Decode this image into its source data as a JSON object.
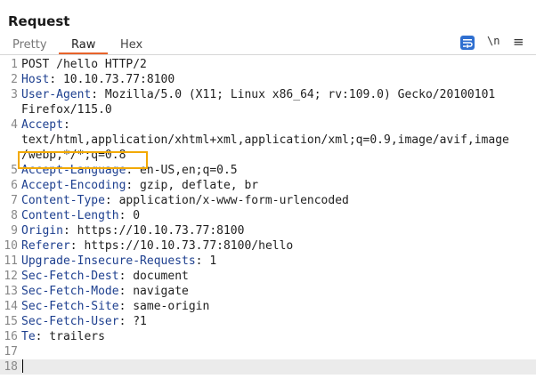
{
  "panel": {
    "title": "Request"
  },
  "tabs": [
    {
      "label": "Pretty",
      "active": false
    },
    {
      "label": "Raw",
      "active": true
    },
    {
      "label": "Hex",
      "active": false
    }
  ],
  "toolbar": {
    "newline_label": "\\n",
    "menu_glyph": "≡",
    "wrap_icon": "wrap-lines-icon",
    "accent": "#2f6fd0"
  },
  "editor": {
    "lines": [
      {
        "n": "1",
        "key": "",
        "text": "POST /hello HTTP/2"
      },
      {
        "n": "2",
        "key": "Host",
        "text": ": 10.10.73.77:8100"
      },
      {
        "n": "3",
        "key": "User-Agent",
        "text": ": Mozilla/5.0 (X11; Linux x86_64; rv:109.0) Gecko/20100101"
      },
      {
        "n": "",
        "key": "",
        "text": "Firefox/115.0"
      },
      {
        "n": "4",
        "key": "Accept",
        "text": ":"
      },
      {
        "n": "",
        "key": "",
        "text": "text/html,application/xhtml+xml,application/xml;q=0.9,image/avif,image"
      },
      {
        "n": "",
        "key": "",
        "text": "/webp,*/*;q=0.8"
      },
      {
        "n": "5",
        "key": "Accept-Language",
        "text": ": en-US,en;q=0.5"
      },
      {
        "n": "6",
        "key": "Accept-Encoding",
        "text": ": gzip, deflate, br"
      },
      {
        "n": "7",
        "key": "Content-Type",
        "text": ": application/x-www-form-urlencoded"
      },
      {
        "n": "8",
        "key": "Content-Length",
        "text": ": 0"
      },
      {
        "n": "9",
        "key": "Origin",
        "text": ": https://10.10.73.77:8100"
      },
      {
        "n": "10",
        "key": "Referer",
        "text": ": https://10.10.73.77:8100/hello"
      },
      {
        "n": "11",
        "key": "Upgrade-Insecure-Requests",
        "text": ": 1"
      },
      {
        "n": "12",
        "key": "Sec-Fetch-Dest",
        "text": ": document"
      },
      {
        "n": "13",
        "key": "Sec-Fetch-Mode",
        "text": ": navigate"
      },
      {
        "n": "14",
        "key": "Sec-Fetch-Site",
        "text": ": same-origin"
      },
      {
        "n": "15",
        "key": "Sec-Fetch-User",
        "text": ": ?1"
      },
      {
        "n": "16",
        "key": "Te",
        "text": ": trailers"
      },
      {
        "n": "17",
        "key": "",
        "text": ""
      },
      {
        "n": "18",
        "key": "",
        "text": ""
      }
    ],
    "highlight_color": "#f2a900"
  }
}
